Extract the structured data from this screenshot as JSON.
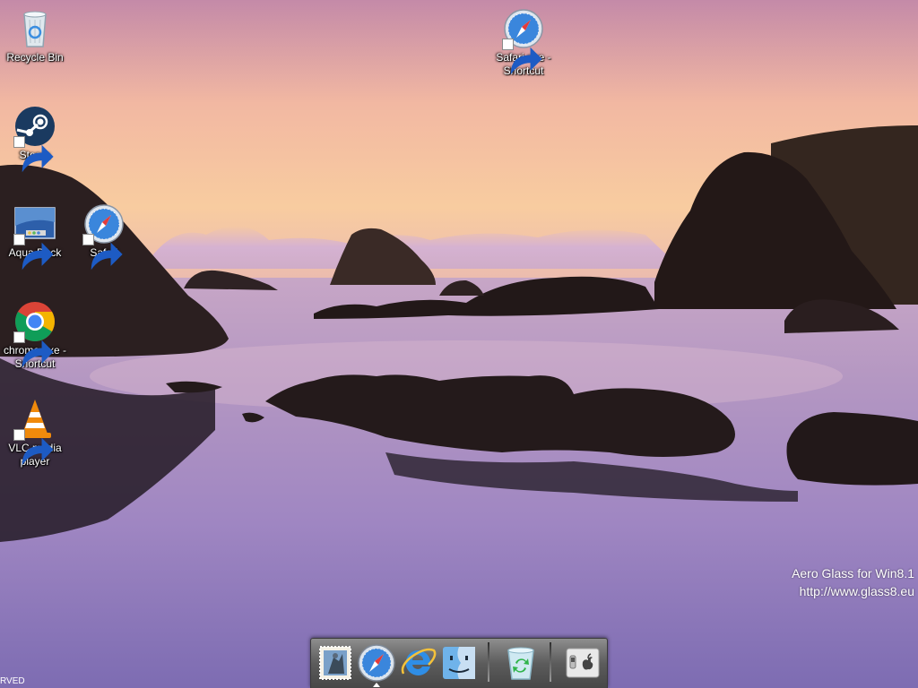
{
  "desktop": {
    "icons": [
      {
        "id": "recycle-bin",
        "label": "Recycle Bin",
        "icon": "recycle-bin-icon"
      },
      {
        "id": "steam",
        "label": "Steam",
        "icon": "steam-icon"
      },
      {
        "id": "aqua-dock",
        "label": "Aqua Dock",
        "icon": "aqua-dock-icon"
      },
      {
        "id": "safari",
        "label": "Safari",
        "icon": "safari-icon"
      },
      {
        "id": "chrome",
        "label": "chrome.exe - Shortcut",
        "icon": "chrome-icon"
      },
      {
        "id": "vlc",
        "label": "VLC media player",
        "icon": "vlc-icon"
      },
      {
        "id": "safari-exe",
        "label": "Safari.exe - Shortcut",
        "icon": "safari-icon"
      }
    ]
  },
  "watermark": {
    "line1": "Aero Glass for Win8.1",
    "line2": "http://www.glass8.eu"
  },
  "bottom_left_text": "RVED",
  "dock": {
    "items": [
      {
        "id": "mail",
        "icon": "mail-stamp-icon"
      },
      {
        "id": "safari",
        "icon": "safari-compass-icon",
        "running": true
      },
      {
        "id": "internet-explorer",
        "icon": "internet-explorer-icon"
      },
      {
        "id": "finder",
        "icon": "finder-icon"
      },
      {
        "id": "recycle-bin",
        "icon": "trash-recycle-icon"
      },
      {
        "id": "system",
        "icon": "apple-switch-icon"
      }
    ]
  },
  "colors": {
    "sky_top": "#c88aa8",
    "sky_mid": "#f7c29e",
    "water": "#8b78b8",
    "rock": "#2a1f22"
  }
}
